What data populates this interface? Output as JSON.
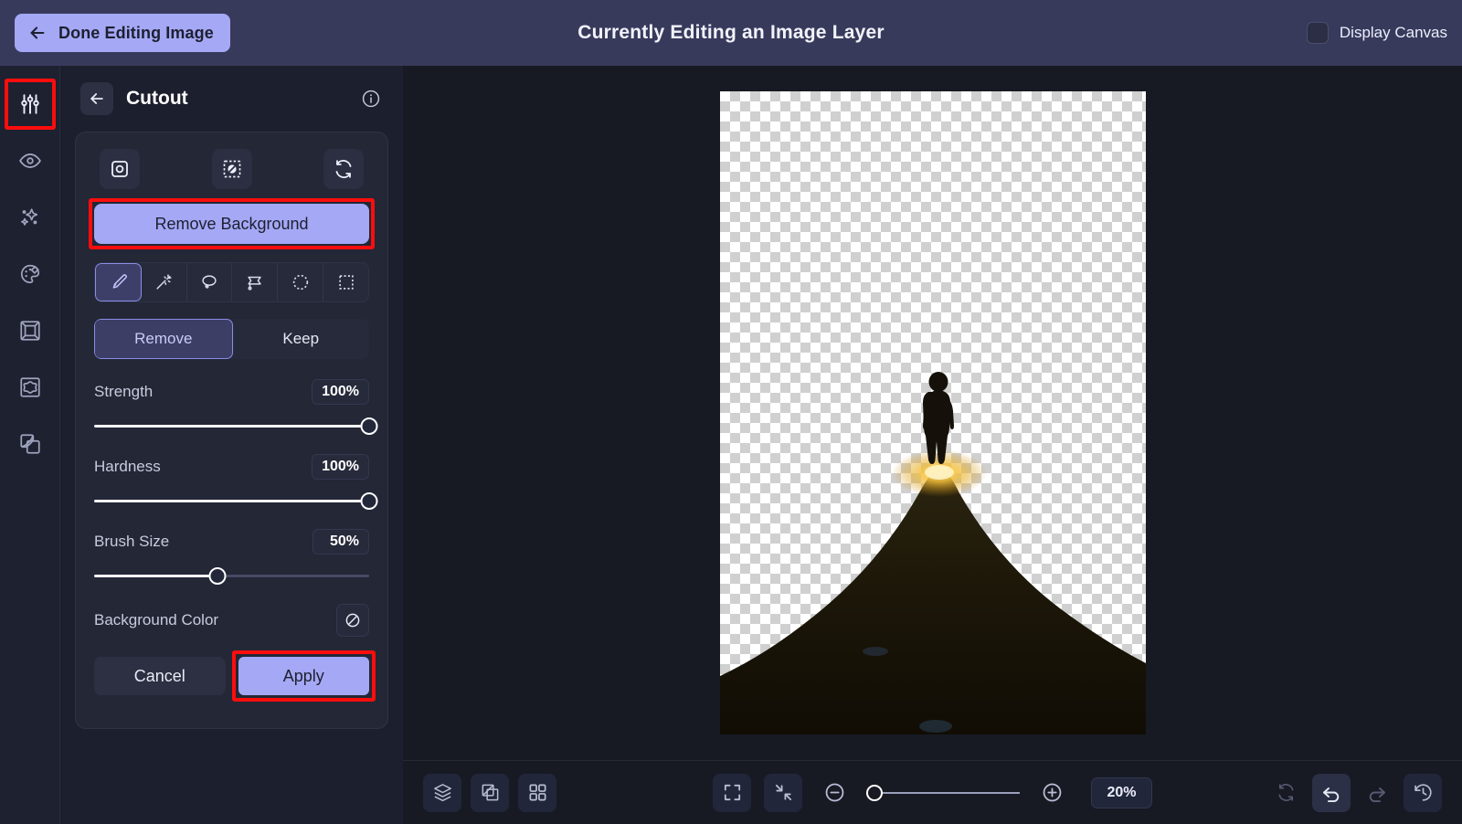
{
  "header": {
    "done_label": "Done Editing Image",
    "back_icon": "arrow-left-icon",
    "title": "Currently Editing an Image Layer",
    "display_canvas_label": "Display Canvas",
    "display_canvas_checked": false,
    "bg_color": "#383a5c",
    "accent_color": "#a5a8f5"
  },
  "rail": {
    "items": [
      {
        "icon": "sliders-icon",
        "name": "adjust",
        "active": true,
        "highlighted": true
      },
      {
        "icon": "eye-icon",
        "name": "visibility",
        "active": false,
        "highlighted": false
      },
      {
        "icon": "sparkles-icon",
        "name": "effects",
        "active": false,
        "highlighted": false
      },
      {
        "icon": "palette-icon",
        "name": "color",
        "active": false,
        "highlighted": false
      },
      {
        "icon": "frame-icon",
        "name": "frame",
        "active": false,
        "highlighted": false
      },
      {
        "icon": "mask-icon",
        "name": "mask",
        "active": false,
        "highlighted": false
      },
      {
        "icon": "layers-overlap-icon",
        "name": "blend",
        "active": false,
        "highlighted": false
      }
    ]
  },
  "panel": {
    "back_icon": "arrow-left-icon",
    "title": "Cutout",
    "info_icon": "info-circle-icon",
    "top_tools": [
      {
        "icon": "select-subject-icon",
        "name": "select-subject"
      },
      {
        "icon": "remove-object-icon",
        "name": "erase-selection"
      },
      {
        "icon": "refresh-icon",
        "name": "reset-cutout"
      }
    ],
    "remove_background_label": "Remove Background",
    "remove_background_highlighted": true,
    "tools": [
      {
        "icon": "brush-icon",
        "name": "brush",
        "active": true
      },
      {
        "icon": "magic-wand-icon",
        "name": "magic-wand",
        "active": false
      },
      {
        "icon": "lasso-icon",
        "name": "lasso",
        "active": false
      },
      {
        "icon": "polygon-lasso-icon",
        "name": "polygon-lasso",
        "active": false
      },
      {
        "icon": "ellipse-select-icon",
        "name": "ellipse-select",
        "active": false
      },
      {
        "icon": "rectangle-select-icon",
        "name": "rectangle-select",
        "active": false
      }
    ],
    "mode": {
      "remove_label": "Remove",
      "keep_label": "Keep",
      "selected": "Remove"
    },
    "sliders": [
      {
        "label": "Strength",
        "value": "100%",
        "percent": 100
      },
      {
        "label": "Hardness",
        "value": "100%",
        "percent": 100
      },
      {
        "label": "Brush Size",
        "value": "50%",
        "percent": 45
      }
    ],
    "background_color": {
      "label": "Background Color",
      "swatch_icon": "no-color-icon",
      "value": "none"
    },
    "cancel_label": "Cancel",
    "apply_label": "Apply",
    "apply_highlighted": true
  },
  "canvas": {
    "description": "Person standing on a dark mountain peak silhouette with golden sunburst, sky removed showing transparency checkerboard",
    "transparent_background": true,
    "mountain_color": "#1a1508",
    "sun_color": "#f5c030"
  },
  "bottombar": {
    "left_tools": [
      {
        "icon": "layers-icon",
        "name": "layers"
      },
      {
        "icon": "transparency-icon",
        "name": "transparency"
      },
      {
        "icon": "grid-icon",
        "name": "grid"
      }
    ],
    "center_tools": [
      {
        "icon": "fit-screen-icon",
        "name": "fit-to-screen"
      },
      {
        "icon": "shrink-icon",
        "name": "shrink-to-fit"
      },
      {
        "icon": "zoom-out-icon",
        "name": "zoom-out"
      }
    ],
    "zoom_percent_label": "20%",
    "zoom_slider_percent": 5,
    "zoom_in_icon": "zoom-in-icon",
    "right_tools": [
      {
        "icon": "reset-icon",
        "name": "reset",
        "state": "dim"
      },
      {
        "icon": "undo-icon",
        "name": "undo",
        "state": "highlighted"
      },
      {
        "icon": "redo-icon",
        "name": "redo",
        "state": "dim"
      },
      {
        "icon": "history-icon",
        "name": "history",
        "state": "normal"
      }
    ]
  }
}
